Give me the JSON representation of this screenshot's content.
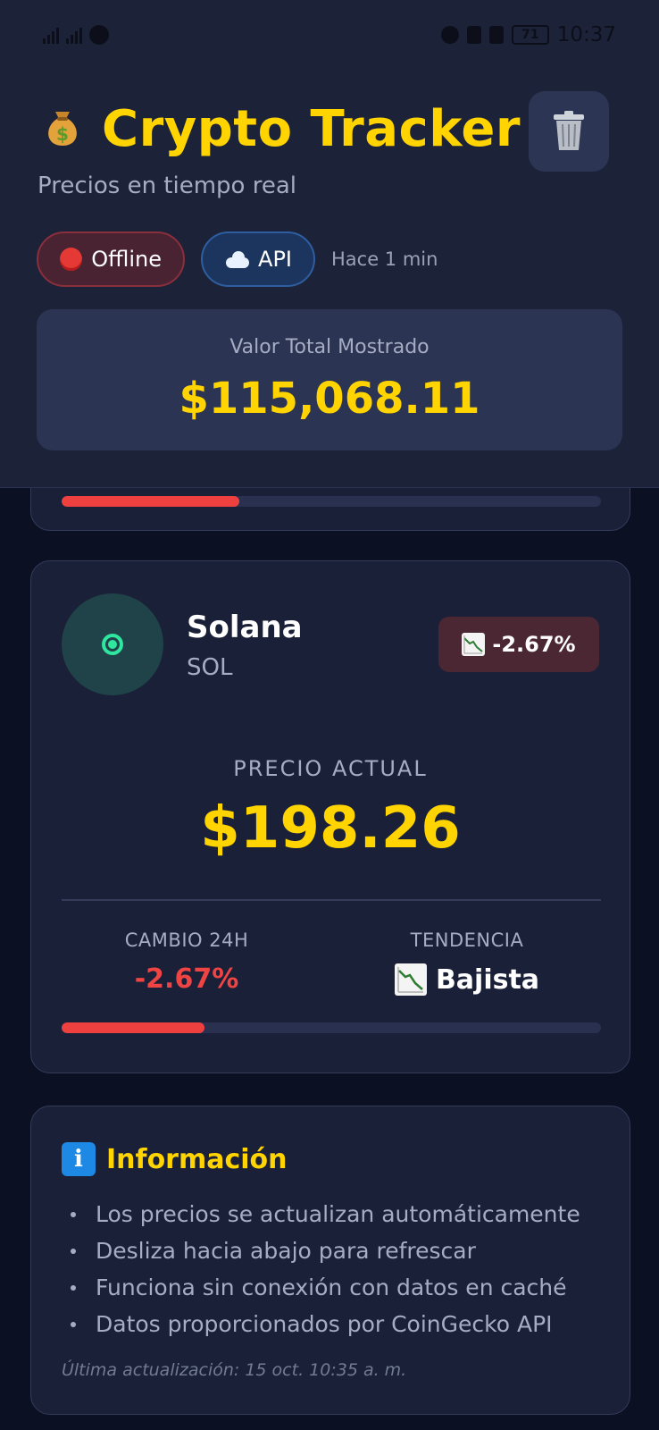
{
  "status_bar": {
    "battery": "71",
    "time": "10:37"
  },
  "header": {
    "title_icon": "money-bag-icon",
    "title": "Crypto Tracker",
    "subtitle": "Precios en tiempo real",
    "trash_icon": "trash-icon",
    "chips": {
      "offline_label": "Offline",
      "api_label": "API"
    },
    "updated_text": "Hace 1 min",
    "total": {
      "label": "Valor Total Mostrado",
      "value": "$115,068.11"
    }
  },
  "previous_card": {
    "progress_fraction": 0.33,
    "progress_color": "#ef4040"
  },
  "coin_card": {
    "name": "Solana",
    "symbol": "SOL",
    "avatar_icon": "target-icon",
    "change_badge": "-2.67%",
    "price_label": "PRECIO ACTUAL",
    "price": "$198.26",
    "stats": {
      "change_label": "CAMBIO 24H",
      "change_value": "-2.67%",
      "trend_label": "TENDENCIA",
      "trend_value": "Bajista"
    },
    "progress_fraction": 0.265,
    "progress_color": "#ef4040"
  },
  "info_card": {
    "title": "Información",
    "items": [
      "Los precios se actualizan automáticamente",
      "Desliza hacia abajo para refrescar",
      "Funciona sin conexión con datos en caché",
      "Datos proporcionados por CoinGecko API"
    ],
    "last_update": "Última actualización: 15 oct. 10:35 a. m."
  },
  "colors": {
    "accent": "#ffd400",
    "negative": "#ef4444",
    "background": "#0b1023",
    "card": "#1a2038"
  }
}
